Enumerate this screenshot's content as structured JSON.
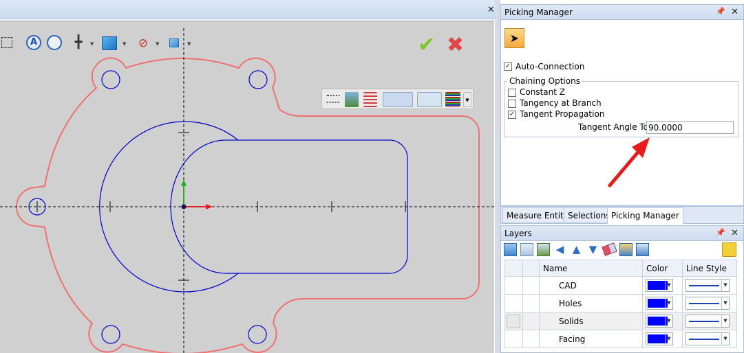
{
  "doc_close_icon": "close-icon",
  "canvas_toolbar": {
    "icons": [
      "box-select-icon",
      "zoom-text-icon",
      "zoom-fit-icon",
      "origin-icon",
      "cube-view-icon",
      "visibility-icon",
      "small-cube-icon"
    ],
    "accept_icon": "checkmark-icon",
    "cancel_icon": "x-icon"
  },
  "layer_toolbar": {
    "icons": [
      "layer-list-icon",
      "layer-stack-icon",
      "layer-lines-icon",
      "layer-fill-icon",
      "line-style-icon",
      "color-stripes-icon"
    ]
  },
  "picking_manager": {
    "title": "Picking Manager",
    "pin": "ᵖ",
    "close": "✕",
    "auto_connection_label": "Auto-Connection",
    "chaining_options_label": "Chaining Options",
    "constant_z_label": "Constant Z",
    "tangency_branch_label": "Tangency at Branch",
    "tangent_propagation_label": "Tangent Propagation",
    "tangent_angle_tol_label": "Tangent Angle Tol",
    "tangent_angle_tol_value": "90.0000",
    "states": {
      "auto_connection": true,
      "constant_z": false,
      "tangency_at_branch": false,
      "tangent_propagation": true
    }
  },
  "bottom_tabs": [
    "Measure Entity",
    "Selections",
    "Picking Manager"
  ],
  "layers": {
    "title": "Layers",
    "pin": "ᵖ",
    "close": "✕",
    "columns": [
      "Name",
      "Color",
      "Line Style"
    ],
    "rows": [
      {
        "name": "CAD",
        "color": "#0000ff"
      },
      {
        "name": "Holes",
        "color": "#0000ff"
      },
      {
        "name": "Solids",
        "color": "#0000ff"
      },
      {
        "name": "Facing",
        "color": "#0000ff"
      }
    ],
    "toolbar_icons": [
      "add-layer-icon",
      "new-layer-icon",
      "layer-props-icon",
      "left-arrow-icon",
      "up-arrow-icon",
      "down-arrow-icon",
      "eraser-icon",
      "import-icon",
      "export-icon",
      "tag-icon"
    ]
  },
  "colors": {
    "part_outline": "#f07070",
    "geometry": "#0000cc",
    "x_axis": "#e02020",
    "y_axis": "#20b020",
    "annotation_arrow": "#e61c1c"
  }
}
